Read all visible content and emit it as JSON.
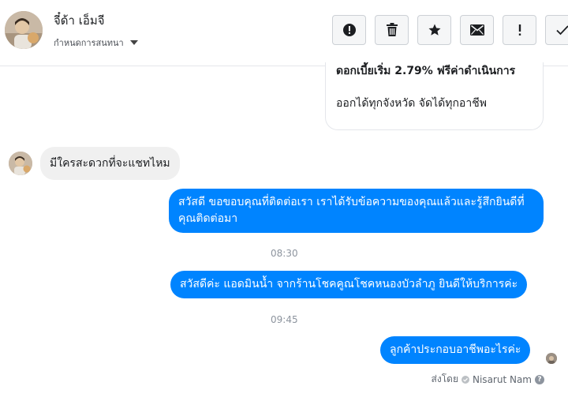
{
  "header": {
    "contact_name": "จี๋ด้า เอ็มจี",
    "conversation_status": "กำหนดการสนทนา",
    "actions": [
      {
        "name": "report-spam",
        "icon": "alert-circle-icon"
      },
      {
        "name": "delete",
        "icon": "trash-icon"
      },
      {
        "name": "star",
        "icon": "star-icon"
      },
      {
        "name": "mark-unread",
        "icon": "envelope-icon"
      },
      {
        "name": "follow-up",
        "icon": "exclamation-icon"
      },
      {
        "name": "mark-done",
        "icon": "checkmark-icon"
      }
    ]
  },
  "ad_card": {
    "title": "ดอกเบี้ยเริ่ม 2.79% ฟรีค่าดำเนินการ",
    "subtitle": "ออกได้ทุกจังหวัด จัดได้ทุกอาชีพ"
  },
  "messages": [
    {
      "direction": "in",
      "text": "มีใครสะดวกที่จะแชทไหม"
    },
    {
      "direction": "out",
      "text": "สวัสดี ขอขอบคุณที่ติดต่อเรา เราได้รับข้อความของคุณแล้วและรู้สึกยินดีที่คุณติดต่อมา"
    },
    {
      "direction": "time",
      "text": "08:30"
    },
    {
      "direction": "out",
      "text": "สวัสดีค่ะ แอดมินน้ำ จากร้านโชคคูณโชคหนองบัวลำภู ยินดีให้บริการค่ะ"
    },
    {
      "direction": "time",
      "text": "09:45"
    },
    {
      "direction": "out",
      "text": "ลูกค้าประกอบอาชีพอะไรค่ะ"
    }
  ],
  "sent_by": {
    "prefix": "ส่งโดย",
    "name": "Nisarut Nam",
    "help": "?"
  },
  "colors": {
    "outgoing_bubble": "#0084ff",
    "incoming_bubble": "#f0f0f0",
    "timestamp": "#8d949e"
  }
}
